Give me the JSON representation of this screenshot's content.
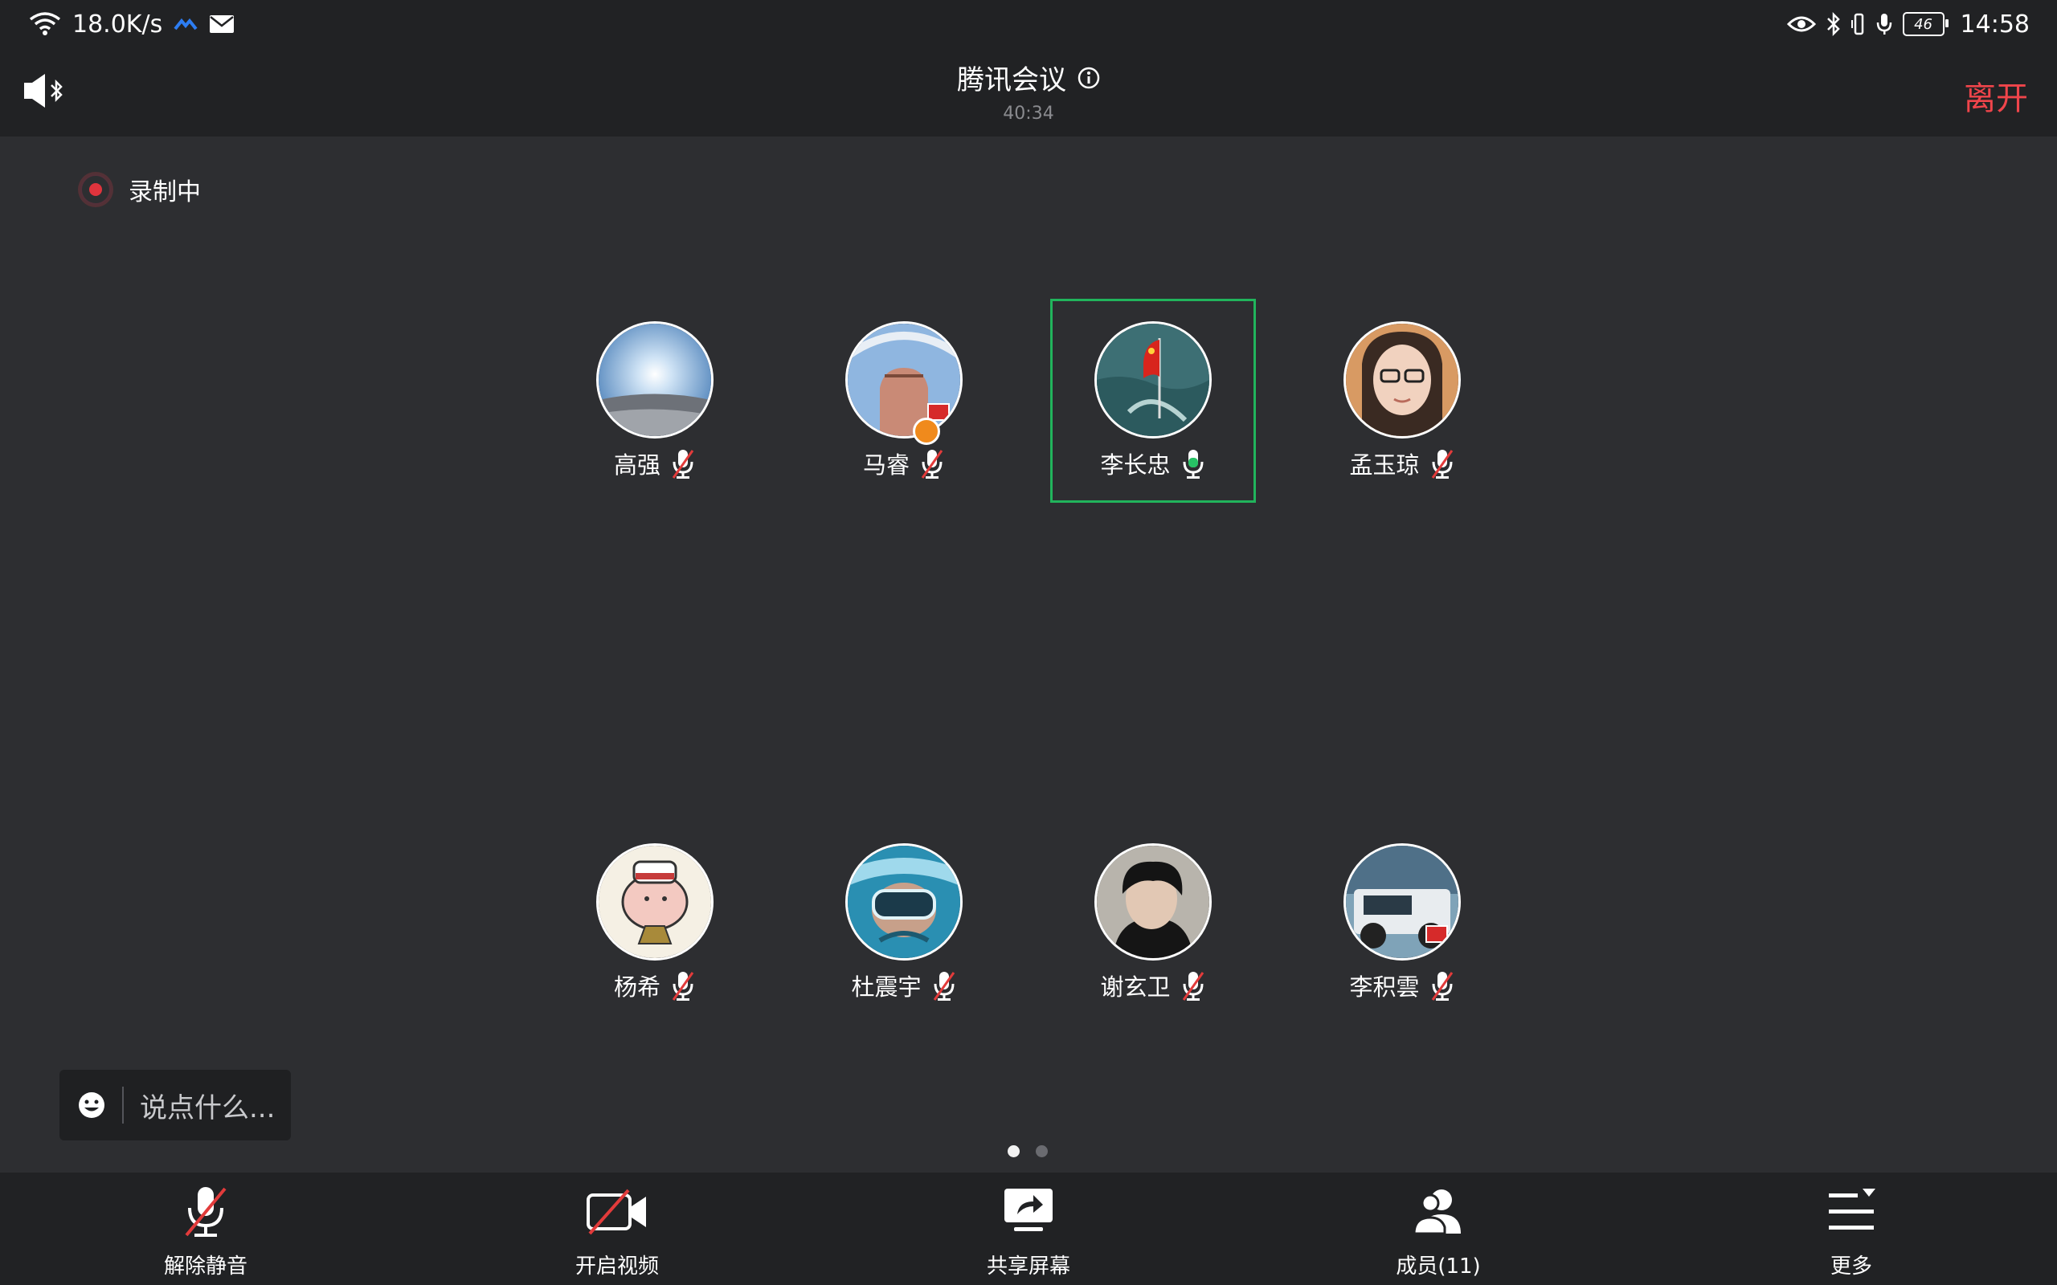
{
  "status_bar": {
    "network_speed": "18.0K/s",
    "battery_level": "46",
    "time": "14:58"
  },
  "header": {
    "title": "腾讯会议",
    "timer": "40:34",
    "leave_label": "离开"
  },
  "recording_label": "录制中",
  "participants": [
    {
      "name": "高强",
      "mic": "muted"
    },
    {
      "name": "马睿",
      "mic": "muted"
    },
    {
      "name": "李长忠",
      "mic": "active"
    },
    {
      "name": "孟玉琼",
      "mic": "muted"
    },
    {
      "name": "杨希",
      "mic": "muted"
    },
    {
      "name": "杜震宇",
      "mic": "muted"
    },
    {
      "name": "谢玄卫",
      "mic": "muted"
    },
    {
      "name": "李积雲",
      "mic": "muted"
    }
  ],
  "chat": {
    "placeholder": "说点什么..."
  },
  "pagination": {
    "pages": 2,
    "current": 1
  },
  "toolbar": {
    "unmute_label": "解除静音",
    "video_label": "开启视频",
    "share_label": "共享屏幕",
    "members_label": "成员(11)",
    "more_label": "更多"
  },
  "colors": {
    "leave": "#f0454b",
    "active_speaker": "#21b45c",
    "recording": "#e0343d"
  }
}
